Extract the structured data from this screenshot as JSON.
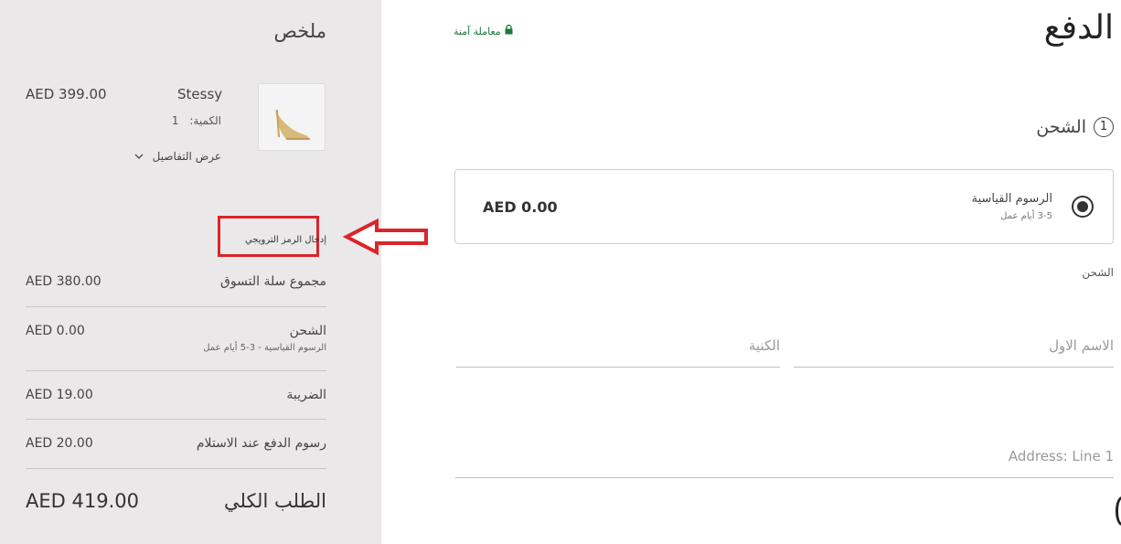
{
  "summary": {
    "title": "ملخص",
    "item": {
      "name": "Stessy",
      "price": "AED 399.00",
      "qty_label": "الكمية:",
      "qty_value": "1",
      "details_link": "عرض التفاصيل"
    },
    "promo_link": "إدخال الرمز الترويجي",
    "rows": [
      {
        "label": "مجموع سلة التسوق",
        "value": "AED 380.00"
      },
      {
        "label": "الشحن",
        "sub": "الرسوم القياسية - 3-5 أيام عمل",
        "value": "AED 0.00"
      },
      {
        "label": "الضريبة",
        "value": "AED 19.00"
      },
      {
        "label": "رسوم الدفع عند الاستلام",
        "value": "AED 20.00"
      }
    ],
    "total_label": "الطلب الكلي",
    "total_value": "AED 419.00"
  },
  "checkout": {
    "title": "الدفع",
    "secure_label": "معاملة آمنة",
    "step": {
      "number": "1",
      "label": "الشحن"
    },
    "shipping_option": {
      "name": "الرسوم القياسية",
      "eta": "3-5 أيام عمل",
      "price": "AED 0.00",
      "selected": true
    },
    "section_label": "الشحن",
    "fields": {
      "first_name_placeholder": "الاسم الاول",
      "last_name_placeholder": "الكنية",
      "address_placeholder": "Address: Line 1"
    }
  },
  "colors": {
    "summary_bg": "#ebe8ea",
    "secure_green": "#1a7a3a",
    "annotation_red": "#d9252b"
  }
}
